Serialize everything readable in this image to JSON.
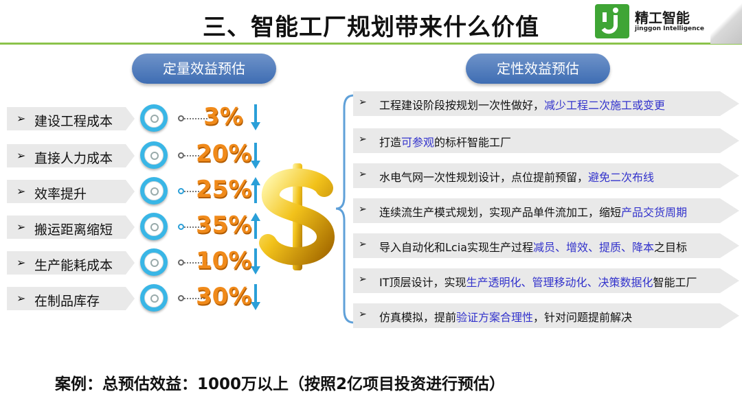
{
  "title": "三、智能工厂规划带来什么价值",
  "logo": {
    "name": "精工智能",
    "english": "jinggon Intelligence"
  },
  "quantitative": {
    "heading": "定量效益预估",
    "rows": [
      {
        "label": "建设工程成本",
        "percent": "3%",
        "direction": "down"
      },
      {
        "label": "直接人力成本",
        "percent": "20%",
        "direction": "down"
      },
      {
        "label": "效率提升",
        "percent": "25%",
        "direction": "up"
      },
      {
        "label": "搬运距离缩短",
        "percent": "35%",
        "direction": "up"
      },
      {
        "label": "生产能耗成本",
        "percent": "10%",
        "direction": "down"
      },
      {
        "label": "在制品库存",
        "percent": "30%",
        "direction": "down"
      }
    ]
  },
  "qualitative": {
    "heading": "定性效益预估",
    "items": [
      {
        "pre": "工程建设阶段按规划一次性做好，",
        "hl": "减少工程二次施工或变更",
        "post": ""
      },
      {
        "pre": "打造",
        "hl": "可参观",
        "post": "的标杆智能工厂"
      },
      {
        "pre": "水电气网一次性规划设计，点位提前预留，",
        "hl": "避免二次布线",
        "post": ""
      },
      {
        "pre": "连续流生产模式规划，实现产品单件流加工，缩短",
        "hl": "产品交货周期",
        "post": ""
      },
      {
        "pre": "导入自动化和Lcia实现生产过程",
        "hl": "减员、增效、提质、降本",
        "post": "之目标"
      },
      {
        "pre": "IT顶层设计，实现",
        "hl": "生产透明化、管理移动化、决策数据化",
        "post": "智能工厂"
      },
      {
        "pre": "仿真模拟，提前",
        "hl": "验证方案合理性",
        "post": "，针对问题提前解决"
      }
    ]
  },
  "footer": "案例：总预估效益：1000万以上（按照2亿项目投资进行预估）",
  "colors": {
    "accent_green": "#8bc34a",
    "pill_blue": "#4a78bb",
    "percent_orange": "#f08a1a",
    "arrow_blue": "#2a9fd8",
    "highlight": "#3333cc"
  }
}
